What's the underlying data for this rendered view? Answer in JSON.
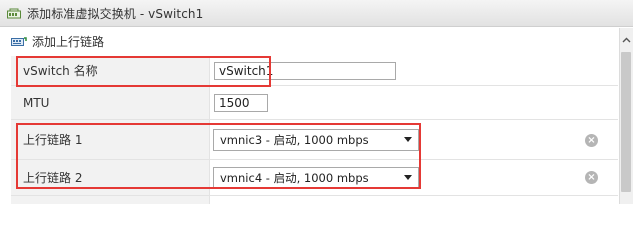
{
  "dialog": {
    "title": "添加标准虚拟交换机 - vSwitch1"
  },
  "toolbar": {
    "add_uplink_label": "添加上行链路"
  },
  "form": {
    "vswitch_name": {
      "label": "vSwitch 名称",
      "value": "vSwitch1"
    },
    "mtu": {
      "label": "MTU",
      "value": "1500"
    },
    "uplinks": [
      {
        "label": "上行链路 1",
        "selected": "vmnic3 - 启动, 1000 mbps"
      },
      {
        "label": "上行链路 2",
        "selected": "vmnic4 - 启动, 1000 mbps"
      }
    ]
  },
  "colors": {
    "highlight": "#e53935",
    "label_bg": "#f2f2f2"
  },
  "icons": [
    "switch-icon",
    "uplink-icon",
    "remove-icon",
    "dropdown-arrow-icon",
    "scroll-up-icon"
  ]
}
